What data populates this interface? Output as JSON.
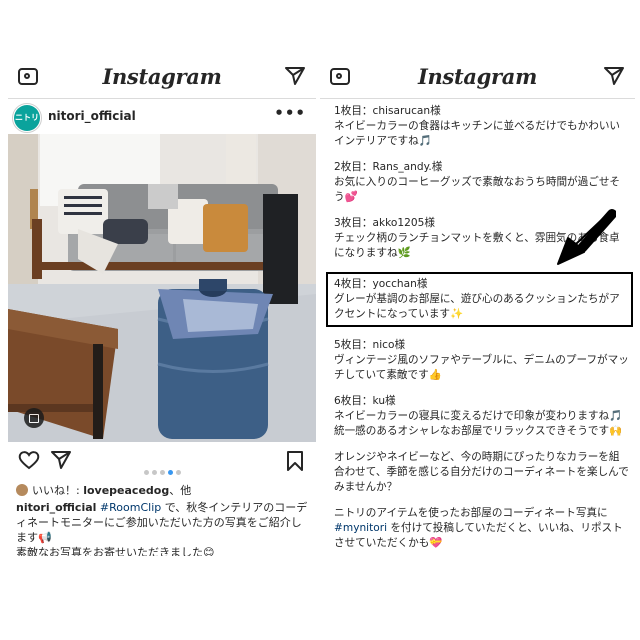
{
  "left": {
    "brand": "Instagram",
    "account": {
      "logo_text": "ニトリ",
      "username": "nitori_official",
      "more": "•••"
    },
    "carousel": {
      "count": 5,
      "active": 4
    },
    "likes": {
      "prefix": "いいね！: ",
      "user": "lovepeacedog",
      "suffix": "、他"
    },
    "caption": {
      "username": "nitori_official",
      "hashtag": "#RoomClip",
      "line1_rest": " で、秋冬インテリアのコーディネートモニターにご参加いただいた方の写真をご紹介します📢",
      "line2": "素敵なお写真をお寄せいただきました😊"
    }
  },
  "right": {
    "brand": "Instagram",
    "entries": [
      {
        "title": "1枚目：chisarucan様",
        "text": "ネイビーカラーの食器はキッチンに並べるだけでもかわいいインテリアですね🎵"
      },
      {
        "title": "2枚目：Rans_andy.様",
        "text": "お気に入りのコーヒーグッズで素敵なおうち時間が過ごせそう💕"
      },
      {
        "title": "3枚目：akko1205様",
        "text": "チェック柄のランチョンマットを敷くと、雰囲気のある食卓になりますね🌿"
      },
      {
        "title": "4枚目：yocchan様",
        "text": "グレーが基調のお部屋に、遊び心のあるクッションたちがアクセントになっています✨"
      },
      {
        "title": "5枚目：nico様",
        "text": "ヴィンテージ風のソファやテーブルに、デニムのプーフがマッチしていて素敵です👍"
      },
      {
        "title": "6枚目：ku様",
        "text": "ネイビーカラーの寝具に変えるだけで印象が変わりますね🎵統一感のあるオシャレなお部屋でリラックスできそうです🙌"
      }
    ],
    "closing1": "オレンジやネイビーなど、今の時期にぴったりなカラーを組合わせて、季節を感じる自分だけのコーディネートを楽しんでみませんか？",
    "closing2_pre": "ニトリのアイテムを使ったお部屋のコーディネート写真に",
    "closing2_tag": "#mynitori",
    "closing2_post": " を付けて投稿していただくと、いいね、リポストさせていただくかも💝"
  },
  "colors": {
    "brand_teal": "#0aa39c",
    "carousel_active": "#3897f0",
    "hashtag": "#00376b"
  }
}
